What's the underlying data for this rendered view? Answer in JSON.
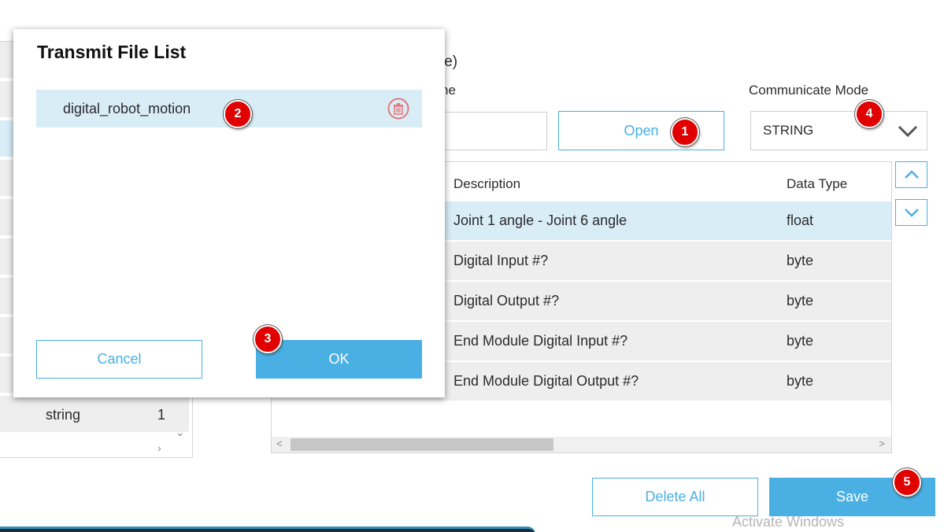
{
  "left_panel": {
    "row_type": "string",
    "row_count": "1"
  },
  "main": {
    "title_fragment": "le)",
    "name_label_fragment": "ne",
    "open_label": "Open",
    "communicate_mode_label": "Communicate Mode",
    "communicate_mode_value": "STRING"
  },
  "table": {
    "headers": {
      "description": "Description",
      "data_type": "Data Type"
    },
    "rows": [
      {
        "description": "Joint 1 angle - Joint 6 angle",
        "type": "float"
      },
      {
        "description": "Digital Input #?",
        "type": "byte"
      },
      {
        "description": "Digital Output #?",
        "type": "byte"
      },
      {
        "description": "End Module Digital Input #?",
        "type": "byte"
      },
      {
        "description": "End Module Digital Output #?",
        "type": "byte"
      }
    ]
  },
  "footer": {
    "delete_all_label": "Delete All",
    "save_label": "Save",
    "watermark": "Activate Windows"
  },
  "dialog": {
    "title": "Transmit File List",
    "file_name": "digital_robot_motion",
    "cancel_label": "Cancel",
    "ok_label": "OK"
  },
  "badges": [
    "1",
    "2",
    "3",
    "4",
    "5"
  ],
  "colors": {
    "accent": "#4ab0e4",
    "selected_row": "#d9edf7",
    "row_bg": "#eeeeee",
    "badge": "#e00000"
  }
}
